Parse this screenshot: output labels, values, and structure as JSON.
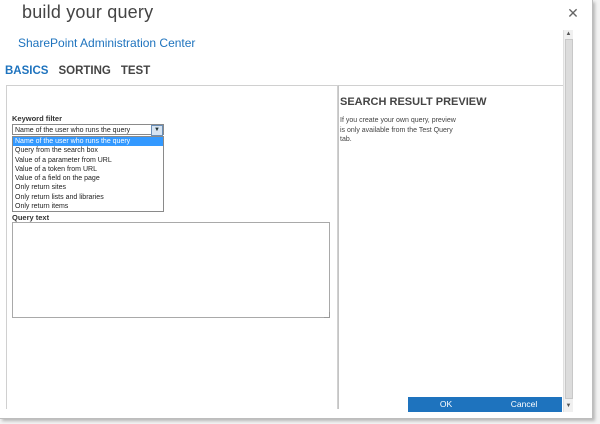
{
  "dialog": {
    "title": "build your query",
    "close_glyph": "✕"
  },
  "site": {
    "name": "SharePoint Administration Center"
  },
  "tabs": [
    {
      "label": "BASICS",
      "active": true
    },
    {
      "label": "SORTING",
      "active": false
    },
    {
      "label": "TEST",
      "active": false
    }
  ],
  "keyword_filter": {
    "label": "Keyword filter",
    "selected": "Name of the user who runs the query",
    "arrow_glyph": "▼",
    "options": [
      "Name of the user who runs the query",
      "Query from the search box",
      "Value of a parameter from URL",
      "Value of a token from URL",
      "Value of a field on the page",
      "Only return sites",
      "Only return lists and libraries",
      "Only return items"
    ]
  },
  "query_text": {
    "label": "Query text",
    "value": ""
  },
  "preview": {
    "title": "SEARCH RESULT PREVIEW",
    "message_line1": "If you create your own query, preview",
    "message_line2": "is only available from the Test Query",
    "message_line3": "tab."
  },
  "scrollbar": {
    "up_glyph": "▲",
    "down_glyph": "▼"
  },
  "buttons": {
    "ok": "OK",
    "cancel": "Cancel"
  },
  "colors": {
    "accent": "#1e73be",
    "selected_option": "#3399ff"
  }
}
